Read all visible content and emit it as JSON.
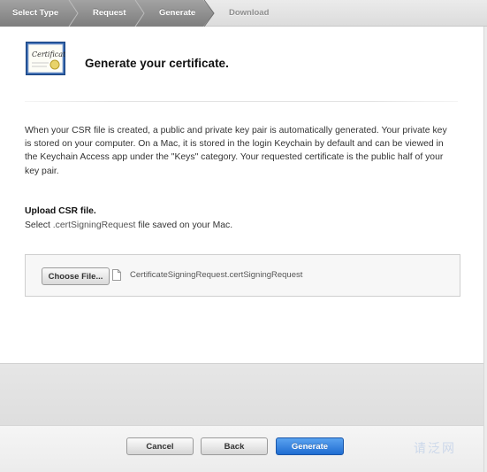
{
  "steps": [
    {
      "label": "Select Type",
      "state": "done"
    },
    {
      "label": "Request",
      "state": "done"
    },
    {
      "label": "Generate",
      "state": "current"
    },
    {
      "label": "Download",
      "state": "todo"
    }
  ],
  "header": {
    "icon": "certificate-icon",
    "title": "Generate your certificate."
  },
  "description": "When your CSR file is created, a public and private key pair is automatically generated. Your private key is stored on your computer. On a Mac, it is stored in the login Keychain by default and can be viewed in the Keychain Access app under the \"Keys\" category. Your requested certificate is the public half of your key pair.",
  "upload": {
    "title": "Upload CSR file.",
    "sub_prefix": "Select",
    "sub_code": ".certSigningRequest",
    "sub_suffix": "file saved on your Mac.",
    "choose_label": "Choose File...",
    "file_icon": "document-icon",
    "file_name": "CertificateSigningRequest.certSigningRequest"
  },
  "footer": {
    "cancel_label": "Cancel",
    "back_label": "Back",
    "generate_label": "Generate"
  },
  "watermark": "请泛网",
  "colors": {
    "primary_button": "#1f6cd1",
    "step_done": "#7e7e7e"
  }
}
